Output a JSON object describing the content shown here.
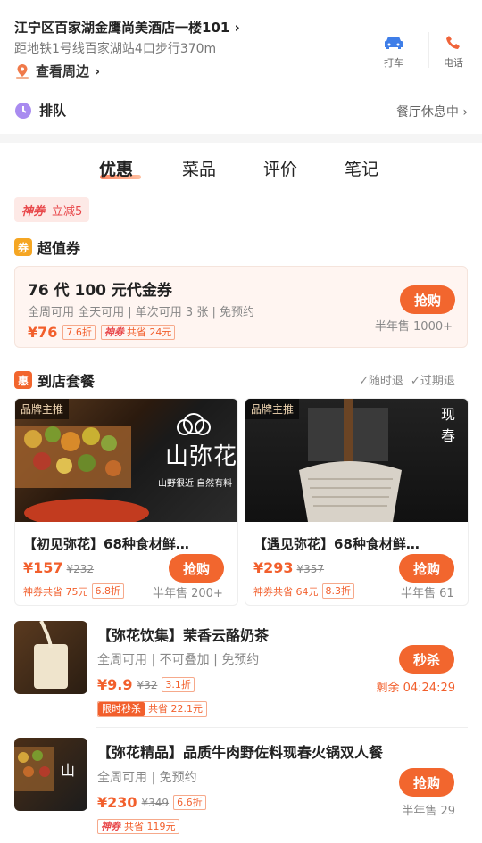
{
  "header": {
    "address": "江宁区百家湖金鹰尚美酒店一楼101",
    "metro": "距地铁1号线百家湖站4口步行370m",
    "nearby": "查看周边",
    "taxi": "打车",
    "phone": "电话"
  },
  "queue": {
    "label": "排队",
    "status": "餐厅休息中"
  },
  "tabs": [
    "优惠",
    "菜品",
    "评价",
    "笔记"
  ],
  "coupon_tag": {
    "shen": "神券",
    "discount": "立减5"
  },
  "voucher_section": {
    "icon": "券",
    "title": "超值券",
    "card": {
      "title": "76 代 100 元代金券",
      "desc": "全周可用 全天可用 | 单次可用 3 张 | 免预约",
      "price": "¥76",
      "discount": "7.6折",
      "shen": "神券",
      "save": "共省 24元",
      "button": "抢购",
      "sold": "半年售 1000+"
    }
  },
  "package_section": {
    "icon": "惠",
    "title": "到店套餐",
    "refund1": "随时退",
    "refund2": "过期退",
    "cards": [
      {
        "badge": "品牌主推",
        "title": "【初见弥花】68种食材鲜…",
        "price": "¥157",
        "orig": "¥232",
        "save": "神券共省 75元",
        "discount": "6.8折",
        "button": "抢购",
        "sold": "半年售 200+",
        "logo_text": "山弥花",
        "slogan": "山野很近 自然有料"
      },
      {
        "badge": "品牌主推",
        "title": "【遇见弥花】68种食材鲜…",
        "price": "¥293",
        "orig": "¥357",
        "save": "神券共省 64元",
        "discount": "8.3折",
        "button": "抢购",
        "sold": "半年售 61",
        "corner": "现春"
      }
    ]
  },
  "items": [
    {
      "title": "【弥花饮集】茉香云酪奶茶",
      "desc": "全周可用 | 不可叠加 | 免预约",
      "price": "¥9.9",
      "orig": "¥32",
      "discount": "3.1折",
      "tag": "限时秒杀",
      "save": "共省 22.1元",
      "button": "秒杀",
      "right_text": "剩余 04:24:29"
    },
    {
      "title": "【弥花精品】品质牛肉野佐料现春火锅双人餐",
      "desc": "全周可用 | 免预约",
      "price": "¥230",
      "orig": "¥349",
      "discount": "6.6折",
      "tag": "神券",
      "save": "共省 119元",
      "button": "抢购",
      "right_text": "半年售 29"
    }
  ],
  "colors": {
    "accent": "#f2662e",
    "shen": "#e8474a"
  }
}
